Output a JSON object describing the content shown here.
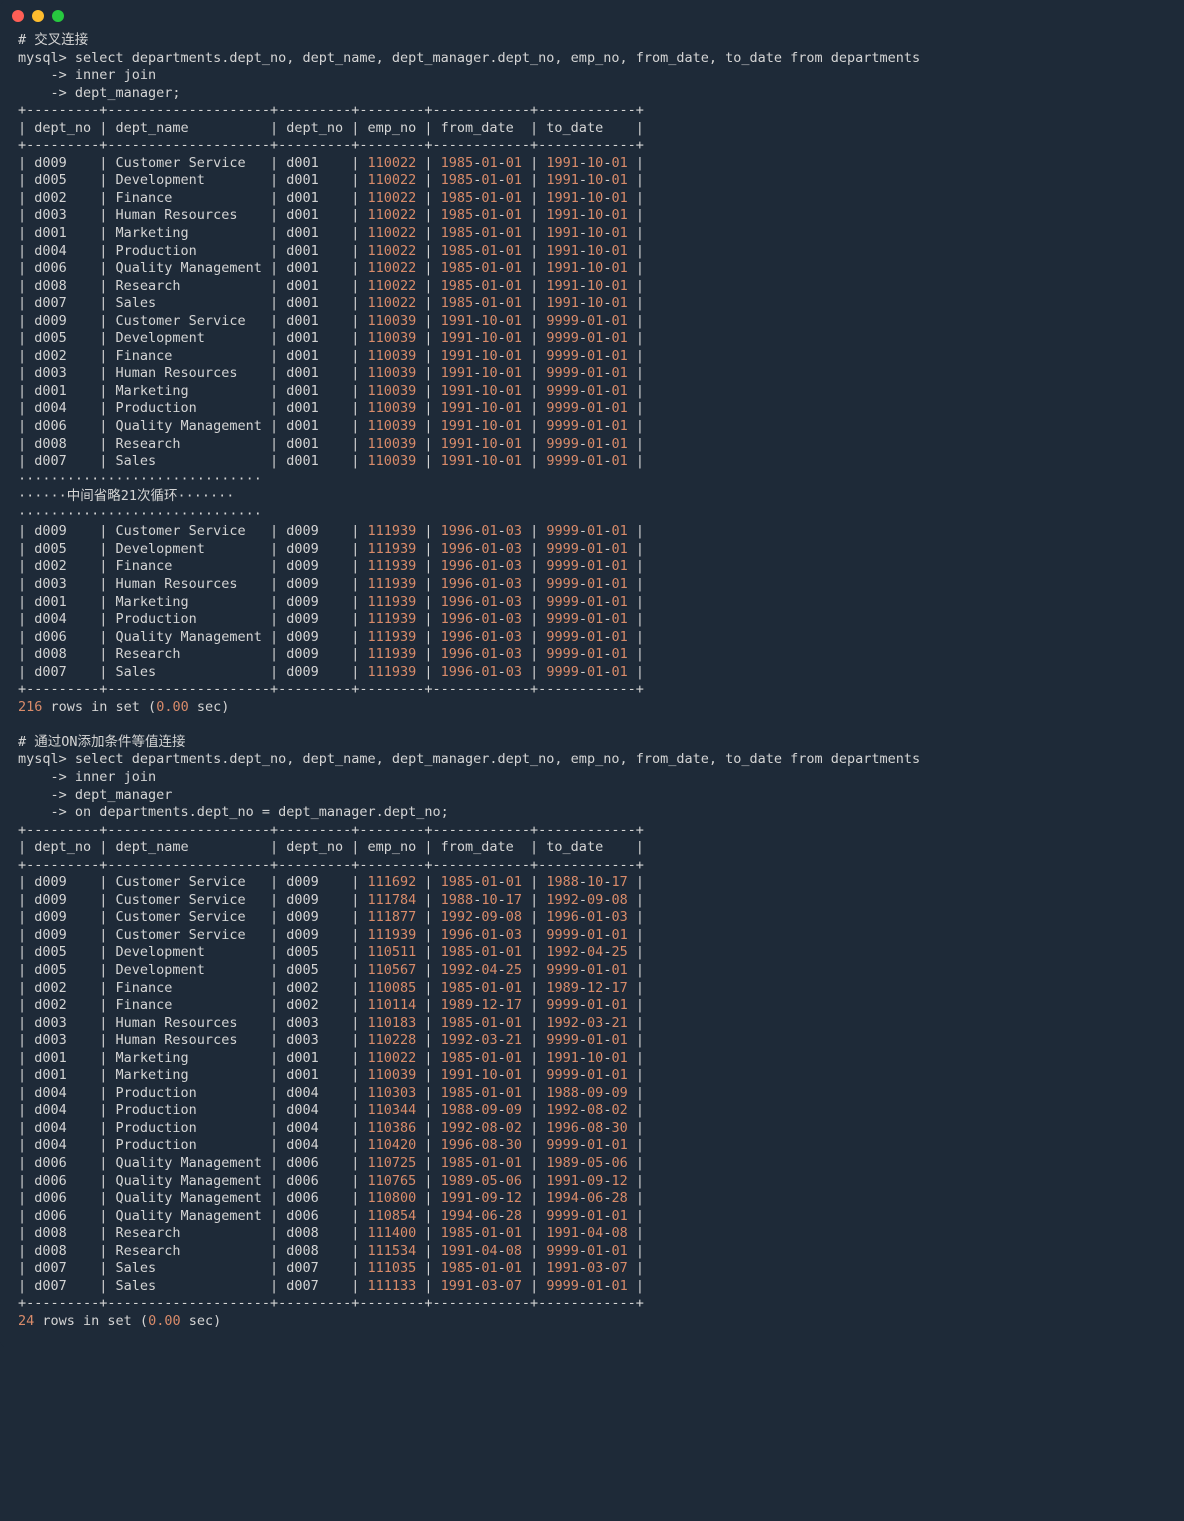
{
  "comments": {
    "c1": "# 交叉连接",
    "c2": "# 通过ON添加条件等值连接"
  },
  "prompts": {
    "p1": "mysql> select departments.dept_no, dept_name, dept_manager.dept_no, emp_no, from_date, to_date from departments",
    "p2": "    -> inner join",
    "p3": "    -> dept_manager;",
    "p4": "mysql> select departments.dept_no, dept_name, dept_manager.dept_no, emp_no, from_date, to_date from departments",
    "p5": "    -> inner join",
    "p6": "    -> dept_manager",
    "p7": "    -> on departments.dept_no = dept_manager.dept_no;"
  },
  "headers": [
    "dept_no",
    "dept_name",
    "dept_no",
    "emp_no",
    "from_date",
    "to_date"
  ],
  "omission": {
    "dots1": "······························",
    "text": "······中间省略21次循环·······",
    "dots2": "······························"
  },
  "footer1": {
    "count": "216",
    "text_a": " rows in set (",
    "time": "0.00",
    "text_b": " sec)"
  },
  "footer2": {
    "count": "24",
    "text_a": " rows in set (",
    "time": "0.00",
    "text_b": " sec)"
  },
  "block1a": [
    [
      "d009",
      "Customer Service",
      "d001",
      "110022",
      "1985",
      "01",
      "01",
      "1991",
      "10",
      "01"
    ],
    [
      "d005",
      "Development",
      "d001",
      "110022",
      "1985",
      "01",
      "01",
      "1991",
      "10",
      "01"
    ],
    [
      "d002",
      "Finance",
      "d001",
      "110022",
      "1985",
      "01",
      "01",
      "1991",
      "10",
      "01"
    ],
    [
      "d003",
      "Human Resources",
      "d001",
      "110022",
      "1985",
      "01",
      "01",
      "1991",
      "10",
      "01"
    ],
    [
      "d001",
      "Marketing",
      "d001",
      "110022",
      "1985",
      "01",
      "01",
      "1991",
      "10",
      "01"
    ],
    [
      "d004",
      "Production",
      "d001",
      "110022",
      "1985",
      "01",
      "01",
      "1991",
      "10",
      "01"
    ],
    [
      "d006",
      "Quality Management",
      "d001",
      "110022",
      "1985",
      "01",
      "01",
      "1991",
      "10",
      "01"
    ],
    [
      "d008",
      "Research",
      "d001",
      "110022",
      "1985",
      "01",
      "01",
      "1991",
      "10",
      "01"
    ],
    [
      "d007",
      "Sales",
      "d001",
      "110022",
      "1985",
      "01",
      "01",
      "1991",
      "10",
      "01"
    ],
    [
      "d009",
      "Customer Service",
      "d001",
      "110039",
      "1991",
      "10",
      "01",
      "9999",
      "01",
      "01"
    ],
    [
      "d005",
      "Development",
      "d001",
      "110039",
      "1991",
      "10",
      "01",
      "9999",
      "01",
      "01"
    ],
    [
      "d002",
      "Finance",
      "d001",
      "110039",
      "1991",
      "10",
      "01",
      "9999",
      "01",
      "01"
    ],
    [
      "d003",
      "Human Resources",
      "d001",
      "110039",
      "1991",
      "10",
      "01",
      "9999",
      "01",
      "01"
    ],
    [
      "d001",
      "Marketing",
      "d001",
      "110039",
      "1991",
      "10",
      "01",
      "9999",
      "01",
      "01"
    ],
    [
      "d004",
      "Production",
      "d001",
      "110039",
      "1991",
      "10",
      "01",
      "9999",
      "01",
      "01"
    ],
    [
      "d006",
      "Quality Management",
      "d001",
      "110039",
      "1991",
      "10",
      "01",
      "9999",
      "01",
      "01"
    ],
    [
      "d008",
      "Research",
      "d001",
      "110039",
      "1991",
      "10",
      "01",
      "9999",
      "01",
      "01"
    ],
    [
      "d007",
      "Sales",
      "d001",
      "110039",
      "1991",
      "10",
      "01",
      "9999",
      "01",
      "01"
    ]
  ],
  "block1b": [
    [
      "d009",
      "Customer Service",
      "d009",
      "111939",
      "1996",
      "01",
      "03",
      "9999",
      "01",
      "01"
    ],
    [
      "d005",
      "Development",
      "d009",
      "111939",
      "1996",
      "01",
      "03",
      "9999",
      "01",
      "01"
    ],
    [
      "d002",
      "Finance",
      "d009",
      "111939",
      "1996",
      "01",
      "03",
      "9999",
      "01",
      "01"
    ],
    [
      "d003",
      "Human Resources",
      "d009",
      "111939",
      "1996",
      "01",
      "03",
      "9999",
      "01",
      "01"
    ],
    [
      "d001",
      "Marketing",
      "d009",
      "111939",
      "1996",
      "01",
      "03",
      "9999",
      "01",
      "01"
    ],
    [
      "d004",
      "Production",
      "d009",
      "111939",
      "1996",
      "01",
      "03",
      "9999",
      "01",
      "01"
    ],
    [
      "d006",
      "Quality Management",
      "d009",
      "111939",
      "1996",
      "01",
      "03",
      "9999",
      "01",
      "01"
    ],
    [
      "d008",
      "Research",
      "d009",
      "111939",
      "1996",
      "01",
      "03",
      "9999",
      "01",
      "01"
    ],
    [
      "d007",
      "Sales",
      "d009",
      "111939",
      "1996",
      "01",
      "03",
      "9999",
      "01",
      "01"
    ]
  ],
  "block2": [
    [
      "d009",
      "Customer Service",
      "d009",
      "111692",
      "1985",
      "01",
      "01",
      "1988",
      "10",
      "17"
    ],
    [
      "d009",
      "Customer Service",
      "d009",
      "111784",
      "1988",
      "10",
      "17",
      "1992",
      "09",
      "08"
    ],
    [
      "d009",
      "Customer Service",
      "d009",
      "111877",
      "1992",
      "09",
      "08",
      "1996",
      "01",
      "03"
    ],
    [
      "d009",
      "Customer Service",
      "d009",
      "111939",
      "1996",
      "01",
      "03",
      "9999",
      "01",
      "01"
    ],
    [
      "d005",
      "Development",
      "d005",
      "110511",
      "1985",
      "01",
      "01",
      "1992",
      "04",
      "25"
    ],
    [
      "d005",
      "Development",
      "d005",
      "110567",
      "1992",
      "04",
      "25",
      "9999",
      "01",
      "01"
    ],
    [
      "d002",
      "Finance",
      "d002",
      "110085",
      "1985",
      "01",
      "01",
      "1989",
      "12",
      "17"
    ],
    [
      "d002",
      "Finance",
      "d002",
      "110114",
      "1989",
      "12",
      "17",
      "9999",
      "01",
      "01"
    ],
    [
      "d003",
      "Human Resources",
      "d003",
      "110183",
      "1985",
      "01",
      "01",
      "1992",
      "03",
      "21"
    ],
    [
      "d003",
      "Human Resources",
      "d003",
      "110228",
      "1992",
      "03",
      "21",
      "9999",
      "01",
      "01"
    ],
    [
      "d001",
      "Marketing",
      "d001",
      "110022",
      "1985",
      "01",
      "01",
      "1991",
      "10",
      "01"
    ],
    [
      "d001",
      "Marketing",
      "d001",
      "110039",
      "1991",
      "10",
      "01",
      "9999",
      "01",
      "01"
    ],
    [
      "d004",
      "Production",
      "d004",
      "110303",
      "1985",
      "01",
      "01",
      "1988",
      "09",
      "09"
    ],
    [
      "d004",
      "Production",
      "d004",
      "110344",
      "1988",
      "09",
      "09",
      "1992",
      "08",
      "02"
    ],
    [
      "d004",
      "Production",
      "d004",
      "110386",
      "1992",
      "08",
      "02",
      "1996",
      "08",
      "30"
    ],
    [
      "d004",
      "Production",
      "d004",
      "110420",
      "1996",
      "08",
      "30",
      "9999",
      "01",
      "01"
    ],
    [
      "d006",
      "Quality Management",
      "d006",
      "110725",
      "1985",
      "01",
      "01",
      "1989",
      "05",
      "06"
    ],
    [
      "d006",
      "Quality Management",
      "d006",
      "110765",
      "1989",
      "05",
      "06",
      "1991",
      "09",
      "12"
    ],
    [
      "d006",
      "Quality Management",
      "d006",
      "110800",
      "1991",
      "09",
      "12",
      "1994",
      "06",
      "28"
    ],
    [
      "d006",
      "Quality Management",
      "d006",
      "110854",
      "1994",
      "06",
      "28",
      "9999",
      "01",
      "01"
    ],
    [
      "d008",
      "Research",
      "d008",
      "111400",
      "1985",
      "01",
      "01",
      "1991",
      "04",
      "08"
    ],
    [
      "d008",
      "Research",
      "d008",
      "111534",
      "1991",
      "04",
      "08",
      "9999",
      "01",
      "01"
    ],
    [
      "d007",
      "Sales",
      "d007",
      "111035",
      "1985",
      "01",
      "01",
      "1991",
      "03",
      "07"
    ],
    [
      "d007",
      "Sales",
      "d007",
      "111133",
      "1991",
      "03",
      "07",
      "9999",
      "01",
      "01"
    ]
  ]
}
